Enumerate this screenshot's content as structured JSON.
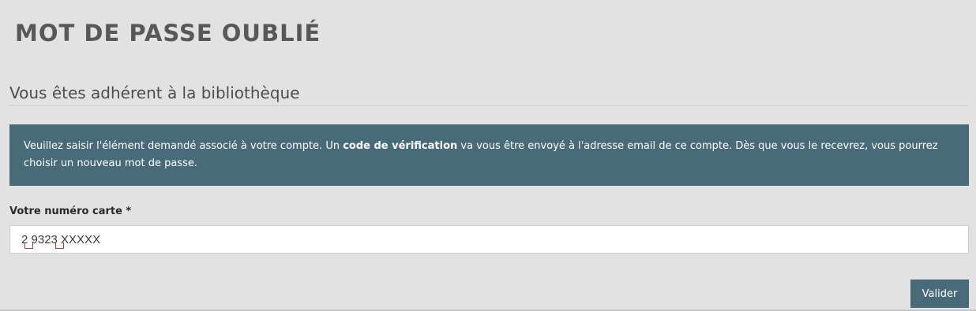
{
  "page": {
    "title": "MOT DE PASSE OUBLIÉ"
  },
  "section": {
    "title": "Vous êtes adhérent à la bibliothèque"
  },
  "info": {
    "text_before": "Veuillez saisir l'élément demandé associé à votre compte. Un ",
    "emphasis": "code de vérification",
    "text_after": " va vous être envoyé à l'adresse email de ce compte. Dès que vous le recevrez, vous pourrez choisir un nouveau mot de passe."
  },
  "form": {
    "card_label": "Votre numéro carte *",
    "card_value": "2 9323 XXXXX",
    "submit_label": "Valider"
  },
  "colors": {
    "background": "#e2e2e2",
    "accent": "#486b7a",
    "spellcheck": "#b0363c"
  }
}
